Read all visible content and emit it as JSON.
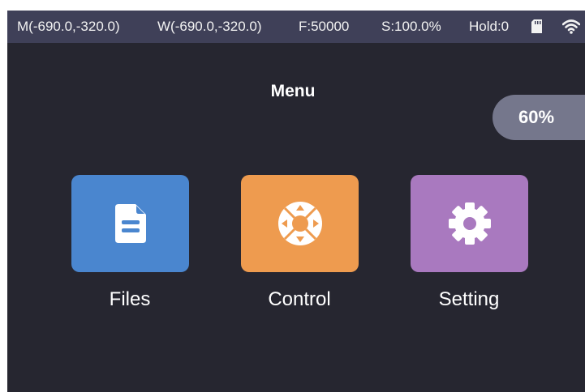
{
  "status": {
    "machine_pos": "M(-690.0,-320.0)",
    "work_pos": "W(-690.0,-320.0)",
    "feed": "F:50000",
    "speed": "S:100.0%",
    "hold": "Hold:0",
    "icons": [
      "sd-card-icon",
      "wifi-icon"
    ]
  },
  "title": "Menu",
  "progress": {
    "label": "60%",
    "value": 60
  },
  "menu": {
    "items": [
      {
        "label": "Files",
        "icon": "file-document-icon",
        "color": "#4a86cf"
      },
      {
        "label": "Control",
        "icon": "direction-pad-icon",
        "color": "#ee9b4f"
      },
      {
        "label": "Setting",
        "icon": "gear-icon",
        "color": "#a979bf"
      }
    ]
  },
  "colors": {
    "background": "#262630",
    "status_bar": "#3f4058",
    "pill": "#75778c"
  }
}
